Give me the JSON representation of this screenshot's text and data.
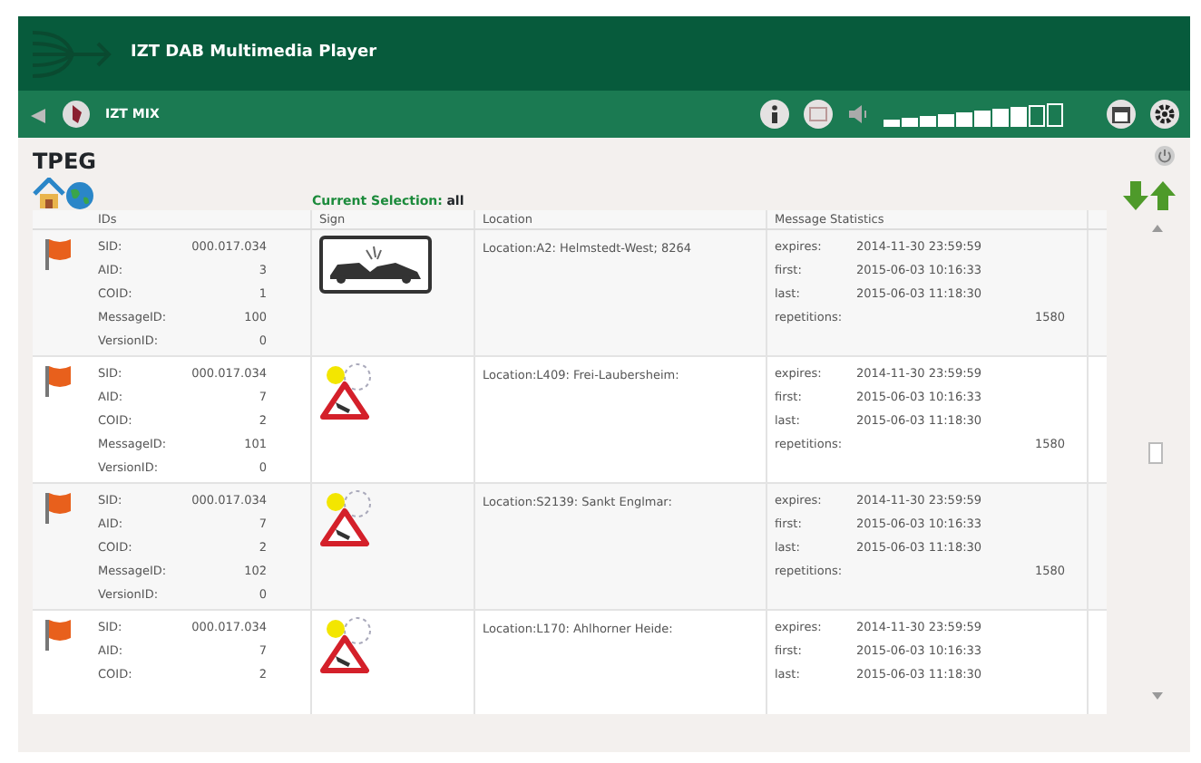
{
  "window": {
    "title": "IZT DAB Multimedia Player"
  },
  "toolbar": {
    "station": "IZT MIX",
    "volume": {
      "level": 0.8
    }
  },
  "panel": {
    "title": "TPEG",
    "selection_label": "Current Selection:",
    "selection_value": "all"
  },
  "table": {
    "columns": [
      "IDs",
      "Sign",
      "Location",
      "Message Statistics"
    ],
    "rows": [
      {
        "ids": [
          [
            "SID:",
            "000.017.034"
          ],
          [
            "AID:",
            "3"
          ],
          [
            "COID:",
            "1"
          ],
          [
            "MessageID:",
            "100"
          ],
          [
            "VersionID:",
            "0"
          ]
        ],
        "sign": {
          "kind": "accident"
        },
        "location": "Location:A2: Helmstedt-West; 8264",
        "stats": [
          [
            "expires:",
            "2014-11-30 23:59:59"
          ],
          [
            "first:",
            "2015-06-03 10:16:33"
          ],
          [
            "last:",
            "2015-06-03 11:18:30"
          ],
          [
            "repetitions:",
            "1580"
          ]
        ]
      },
      {
        "ids": [
          [
            "SID:",
            "000.017.034"
          ],
          [
            "AID:",
            "7"
          ],
          [
            "COID:",
            "2"
          ],
          [
            "MessageID:",
            "101"
          ],
          [
            "VersionID:",
            "0"
          ]
        ],
        "sign": {
          "kind": "warning"
        },
        "location": "Location:L409: Frei-Laubersheim:",
        "stats": [
          [
            "expires:",
            "2014-11-30 23:59:59"
          ],
          [
            "first:",
            "2015-06-03 10:16:33"
          ],
          [
            "last:",
            "2015-06-03 11:18:30"
          ],
          [
            "repetitions:",
            "1580"
          ]
        ]
      },
      {
        "ids": [
          [
            "SID:",
            "000.017.034"
          ],
          [
            "AID:",
            "7"
          ],
          [
            "COID:",
            "2"
          ],
          [
            "MessageID:",
            "102"
          ],
          [
            "VersionID:",
            "0"
          ]
        ],
        "sign": {
          "kind": "warning"
        },
        "location": "Location:S2139: Sankt Englmar:",
        "stats": [
          [
            "expires:",
            "2014-11-30 23:59:59"
          ],
          [
            "first:",
            "2015-06-03 10:16:33"
          ],
          [
            "last:",
            "2015-06-03 11:18:30"
          ],
          [
            "repetitions:",
            "1580"
          ]
        ]
      },
      {
        "ids": [
          [
            "SID:",
            "000.017.034"
          ],
          [
            "AID:",
            "7"
          ],
          [
            "COID:",
            "2"
          ]
        ],
        "sign": {
          "kind": "warning"
        },
        "location": "Location:L170: Ahlhorner Heide:",
        "stats": [
          [
            "expires:",
            "2014-11-30 23:59:59"
          ],
          [
            "first:",
            "2015-06-03 10:16:33"
          ],
          [
            "last:",
            "2015-06-03 11:18:30"
          ]
        ]
      }
    ]
  }
}
